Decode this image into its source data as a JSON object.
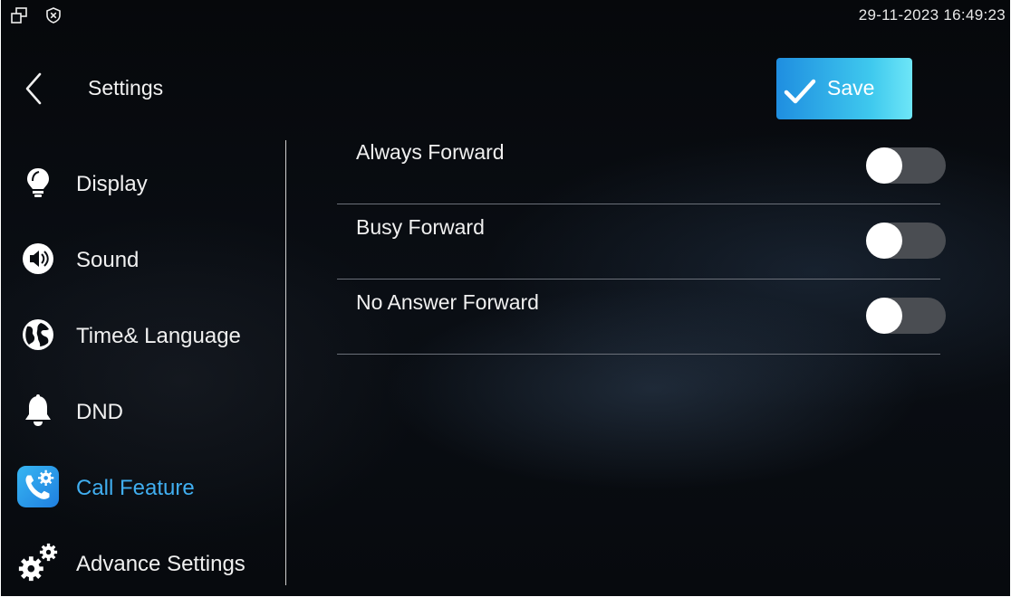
{
  "status_bar": {
    "datetime": "29-11-2023 16:49:23",
    "icons": [
      "windows-icon",
      "shield-x-icon"
    ]
  },
  "header": {
    "title": "Settings",
    "save_label": "Save",
    "save_color": "#3fc9ee"
  },
  "sidebar": {
    "items": [
      {
        "label": "Display",
        "icon": "lightbulb-icon",
        "active": false
      },
      {
        "label": "Sound",
        "icon": "speaker-icon",
        "active": false
      },
      {
        "label": "Time& Language",
        "icon": "globe-icon",
        "active": false
      },
      {
        "label": "DND",
        "icon": "bell-icon",
        "active": false
      },
      {
        "label": "Call Feature",
        "icon": "phone-settings-icon",
        "active": true
      },
      {
        "label": "Advance Settings",
        "icon": "gears-icon",
        "active": false
      }
    ],
    "active_color": "#40aef0"
  },
  "settings": [
    {
      "label": "Always Forward",
      "enabled": false
    },
    {
      "label": "Busy Forward",
      "enabled": false
    },
    {
      "label": "No Answer Forward",
      "enabled": false
    }
  ]
}
